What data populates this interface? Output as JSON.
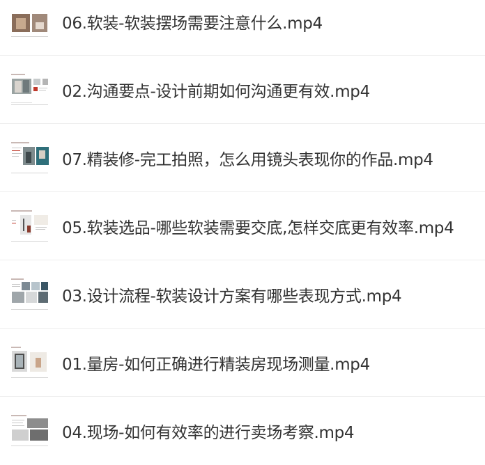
{
  "files": [
    {
      "name": "06.软装-软装摆场需要注意什么.mp4",
      "thumbnail": "video-thumbnail"
    },
    {
      "name": "02.沟通要点-设计前期如何沟通更有效.mp4",
      "thumbnail": "video-thumbnail"
    },
    {
      "name": "07.精装修-完工拍照，怎么用镜头表现你的作品.mp4",
      "thumbnail": "video-thumbnail"
    },
    {
      "name": "05.软装选品-哪些软装需要交底,怎样交底更有效率.mp4",
      "thumbnail": "video-thumbnail"
    },
    {
      "name": "03.设计流程-软装设计方案有哪些表现方式.mp4",
      "thumbnail": "video-thumbnail"
    },
    {
      "name": "01.量房-如何正确进行精装房现场测量.mp4",
      "thumbnail": "video-thumbnail"
    },
    {
      "name": "04.现场-如何有效率的进行卖场考察.mp4",
      "thumbnail": "video-thumbnail"
    }
  ]
}
